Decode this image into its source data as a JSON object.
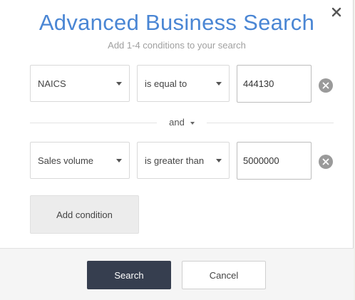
{
  "dialog": {
    "title": "Advanced Business Search",
    "subtitle": "Add 1-4 conditions to your search",
    "close_icon": "close-icon"
  },
  "conditions": [
    {
      "field": "NAICS",
      "operator": "is equal to",
      "value": "444130"
    },
    {
      "field": "Sales volume",
      "operator": "is greater than",
      "value": "5000000"
    }
  ],
  "conjunction": {
    "label": "and"
  },
  "add_condition_label": "Add condition",
  "footer": {
    "search_label": "Search",
    "cancel_label": "Cancel"
  },
  "colors": {
    "title": "#4a86d4",
    "primary_button": "#363e4f",
    "remove_icon": "#9a9a9a"
  }
}
